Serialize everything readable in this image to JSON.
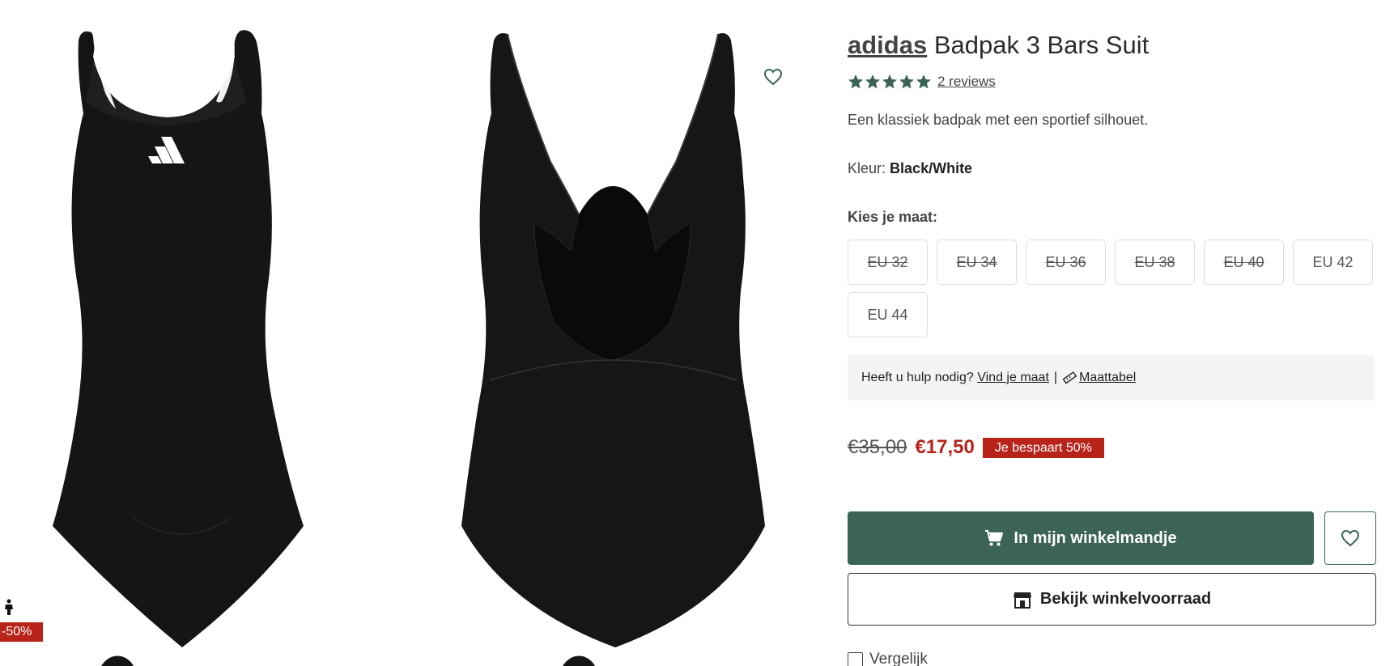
{
  "product": {
    "brand": "adidas",
    "name": "Badpak 3 Bars Suit",
    "rating_stars": 5,
    "reviews_label": "2 reviews",
    "description": "Een klassiek badpak met een sportief silhouet.",
    "color_label": "Kleur:",
    "color_value": "Black/White"
  },
  "gallery": {
    "discount_badge": "-50%",
    "images": [
      "front-view",
      "back-view"
    ]
  },
  "sizes": {
    "label": "Kies je maat:",
    "options": [
      {
        "label": "EU 32",
        "available": false
      },
      {
        "label": "EU 34",
        "available": false
      },
      {
        "label": "EU 36",
        "available": false
      },
      {
        "label": "EU 38",
        "available": false
      },
      {
        "label": "EU 40",
        "available": false
      },
      {
        "label": "EU 42",
        "available": true
      },
      {
        "label": "EU 44",
        "available": true
      }
    ]
  },
  "help": {
    "text": "Heeft u hulp nodig?",
    "find_size_link": "Vind je maat",
    "separator": "|",
    "size_chart_link": "Maattabel"
  },
  "price": {
    "old": "€35,00",
    "new": "€17,50",
    "savings": "Je bespaart 50%"
  },
  "actions": {
    "add_to_cart": "In mijn winkelmandje",
    "store_stock": "Bekijk winkelvoorraad",
    "compare": "Vergelijk"
  },
  "colors": {
    "accent_green": "#3b6454",
    "sale_red": "#b8231a",
    "star_green": "#3b6454"
  },
  "icons": [
    "heart-icon",
    "star-icon",
    "ruler-icon",
    "cart-icon",
    "store-icon",
    "person-icon"
  ]
}
